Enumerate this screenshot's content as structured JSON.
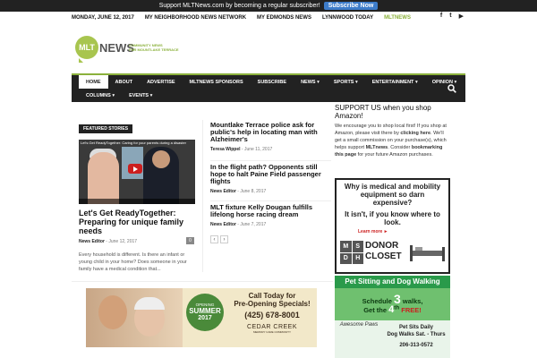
{
  "support_bar": {
    "text": "Support MLTNews.com by becoming a regular subscriber!",
    "button": "Subscribe Now"
  },
  "topbar": {
    "date": "MONDAY, JUNE 12, 2017",
    "links": [
      "MY NEIGHBORHOOD NEWS NETWORK",
      "MY EDMONDS NEWS",
      "LYNNWOOD TODAY",
      "MLTNEWS"
    ]
  },
  "social": {
    "facebook": "f",
    "twitter": "t",
    "youtube": "▶"
  },
  "logo": {
    "bubble": "MLT",
    "word": "NEWS",
    "tagline1": "COMMUNITY NEWS",
    "tagline2": "FOR MOUNTLAKE TERRACE"
  },
  "nav": {
    "row1": [
      "HOME",
      "ABOUT",
      "ADVERTISE",
      "MLTNEWS SPONSORS",
      "SUBSCRIBE",
      "NEWS ▾",
      "SPORTS ▾",
      "ENTERTAINMENT ▾",
      "OPINION ▾"
    ],
    "row2": [
      "COLUMNS ▾",
      "EVENTS ▾"
    ]
  },
  "featured": {
    "badge": "FEATURED STORIES",
    "video_title": "Let's Get ReadyTogether: Caring for your parents during a disaster",
    "title": "Let's Get ReadyTogether: Preparing for unique family needs",
    "author": "News Editor",
    "date": "June 12, 2017",
    "comments": "0",
    "excerpt": "Every household is different. Is there an infant or young child in your home? Does someone in your family have a medical condition that..."
  },
  "stories": [
    {
      "title": "Mountlake Terrace police ask for public's help in locating man with Alzheimer's",
      "author": "Teresa Wippel",
      "date": "June 11, 2017"
    },
    {
      "title": "In the flight path? Opponents still hope to halt Paine Field passenger flights",
      "author": "News Editor",
      "date": "June 8, 2017"
    },
    {
      "title": "MLT fixture Kelly Dougan fulfills lifelong horse racing dream",
      "author": "News Editor",
      "date": "June 7, 2017"
    }
  ],
  "pager": {
    "prev": "‹",
    "next": "›"
  },
  "ad_cedar": {
    "opening": "OPENING",
    "summer": "SUMMER",
    "year": "2017",
    "line1": "Call Today for",
    "line2": "Pre-Opening Specials!",
    "phone": "(425) 678-8001",
    "brand": "CEDAR CREEK",
    "brand_sub": "MEMORY CARE COMMUNITY"
  },
  "sidebar": {
    "title": "SUPPORT US when you shop Amazon!",
    "text1": "We encourage you to shop local first! If you shop at Amazon, please visit there by ",
    "link1": "clicking here",
    "text2": ". We'll get a small commission on your purchase(s), which helps support ",
    "bold1": "MLTnews",
    "text3": ". Consider ",
    "link2": "bookmarking this page",
    "text4": " for your future Amazon purchases."
  },
  "ad_donor": {
    "question": "Why is medical and mobility equipment so darn expensive?",
    "answer": "It isn't, if you know where to look.",
    "learn": "Learn more ►",
    "letters": [
      "M",
      "S",
      "D",
      "H"
    ],
    "brand1": "DONOR",
    "brand2": "CLOSET"
  },
  "ad_pets": {
    "header": "Pet Sitting and Dog Walking",
    "line1_a": "Schedule ",
    "line1_num": "3",
    "line1_b": " walks,",
    "line2_a": "Get the ",
    "line2_num": "4",
    "line2_sup": "th",
    "line2_b": " FREE!",
    "paws": "Awesome Paws",
    "info1": "Pet Sits Daily",
    "info2": "Dog Walks Sat. - Thurs",
    "phone": "206-313-0572"
  },
  "colors": {
    "accent": "#8bb13c",
    "nav_bg": "#222222",
    "subscribe": "#3d7cc9"
  }
}
